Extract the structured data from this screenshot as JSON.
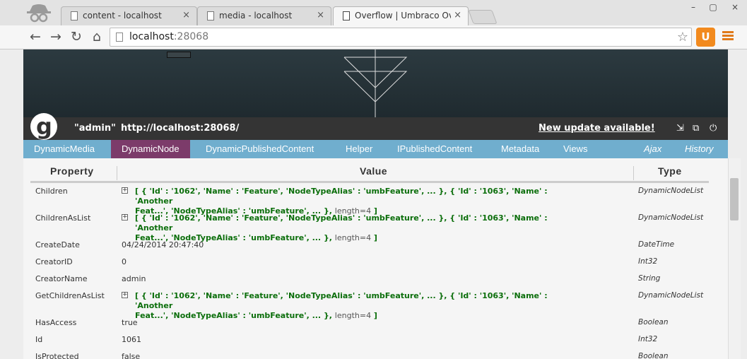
{
  "browser": {
    "tabs": [
      {
        "title": "content - localhost",
        "close": "×"
      },
      {
        "title": "media - localhost",
        "close": "×"
      },
      {
        "title": "Overflow | Umbraco Overf",
        "close": "×"
      }
    ],
    "window_controls": {
      "minimize": "–",
      "maximize": "▢",
      "close": "×"
    },
    "url_host": "localhost",
    "url_port": ":28068",
    "nav": {
      "back": "←",
      "forward": "→",
      "reload": "↻",
      "home": "⌂"
    },
    "star": "☆",
    "extension": "U",
    "colors": {
      "extension": "#f28a1e",
      "menu": "#e07a1a"
    }
  },
  "glimpse": {
    "logo": "g",
    "user": "\"admin\"",
    "url": "http://localhost:28068/",
    "update_link": "New update available!",
    "icons": {
      "dock": "⇲",
      "popout": "⧉",
      "power": "⏻"
    },
    "tabs": [
      {
        "label": "DynamicMedia",
        "active": false
      },
      {
        "label": "DynamicNode",
        "active": true
      },
      {
        "label": "DynamicPublishedContent",
        "active": false
      },
      {
        "label": "Helper",
        "active": false
      },
      {
        "label": "IPublishedContent",
        "active": false
      },
      {
        "label": "Metadata",
        "active": false
      },
      {
        "label": "Views",
        "active": false
      }
    ],
    "right_tabs": [
      {
        "label": "Ajax"
      },
      {
        "label": "History"
      }
    ],
    "colors": {
      "tabbar": "#70aece",
      "active_tab": "#7c3b6a",
      "toolbar": "#343434",
      "code": "#0b6e0b"
    }
  },
  "table": {
    "headers": {
      "property": "Property",
      "value": "Value",
      "type": "Type"
    },
    "expand_glyph": "+",
    "rows": [
      {
        "property": "Children",
        "line1": "[ { 'Id' : '1062', 'Name' : 'Feature', 'NodeTypeAlias' : 'umbFeature', ... }, { 'Id' : '1063', 'Name' : 'Another",
        "line2": "Feat...', 'NodeTypeAlias' : 'umbFeature', ... }, ",
        "length": "length=4",
        "close": " ]",
        "type": "DynamicNodeList"
      },
      {
        "property": "ChildrenAsList",
        "line1": "[ { 'Id' : '1062', 'Name' : 'Feature', 'NodeTypeAlias' : 'umbFeature', ... }, { 'Id' : '1063', 'Name' : 'Another",
        "line2": "Feat...', 'NodeTypeAlias' : 'umbFeature', ... }, ",
        "length": "length=4",
        "close": " ]",
        "type": "DynamicNodeList"
      },
      {
        "property": "CreateDate",
        "value": "04/24/2014 20:47:40",
        "type": "DateTime"
      },
      {
        "property": "CreatorID",
        "value": "0",
        "type": "Int32"
      },
      {
        "property": "CreatorName",
        "value": "admin",
        "type": "String"
      },
      {
        "property": "GetChildrenAsList",
        "line1": "[ { 'Id' : '1062', 'Name' : 'Feature', 'NodeTypeAlias' : 'umbFeature', ... }, { 'Id' : '1063', 'Name' : 'Another",
        "line2": "Feat...', 'NodeTypeAlias' : 'umbFeature', ... }, ",
        "length": "length=4",
        "close": " ]",
        "type": "DynamicNodeList"
      },
      {
        "property": "HasAccess",
        "value": "true",
        "type": "Boolean"
      },
      {
        "property": "Id",
        "value": "1061",
        "type": "Int32"
      },
      {
        "property": "IsProtected",
        "value": "false",
        "type": "Boolean"
      }
    ]
  }
}
